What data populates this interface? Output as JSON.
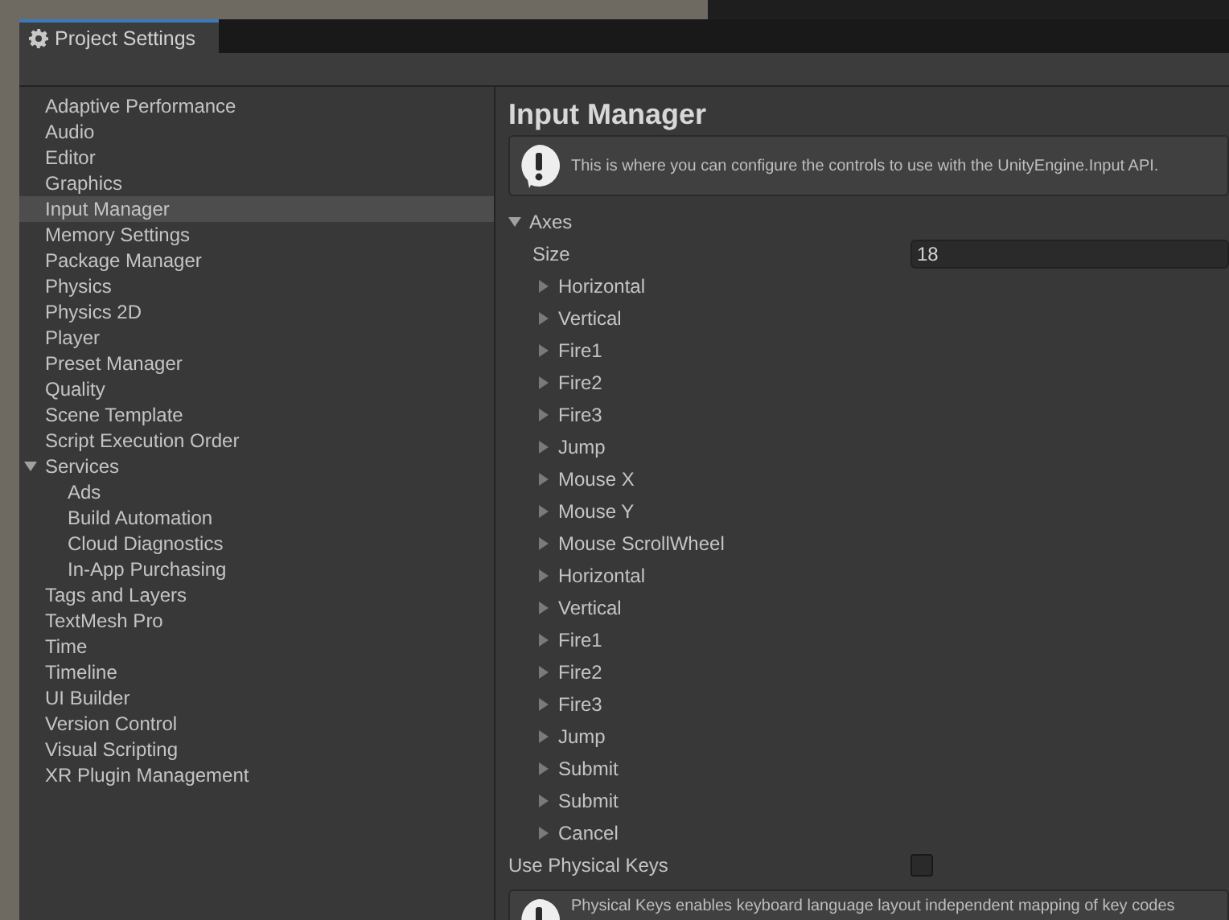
{
  "window": {
    "title": "Project Settings"
  },
  "sidebar": {
    "items": [
      {
        "label": "Adaptive Performance",
        "selected": false
      },
      {
        "label": "Audio",
        "selected": false
      },
      {
        "label": "Editor",
        "selected": false
      },
      {
        "label": "Graphics",
        "selected": false
      },
      {
        "label": "Input Manager",
        "selected": true
      },
      {
        "label": "Memory Settings",
        "selected": false
      },
      {
        "label": "Package Manager",
        "selected": false
      },
      {
        "label": "Physics",
        "selected": false
      },
      {
        "label": "Physics 2D",
        "selected": false
      },
      {
        "label": "Player",
        "selected": false
      },
      {
        "label": "Preset Manager",
        "selected": false
      },
      {
        "label": "Quality",
        "selected": false
      },
      {
        "label": "Scene Template",
        "selected": false
      },
      {
        "label": "Script Execution Order",
        "selected": false
      },
      {
        "label": "Services",
        "selected": false,
        "expanded": true,
        "children": [
          {
            "label": "Ads",
            "selected": false
          },
          {
            "label": "Build Automation",
            "selected": false
          },
          {
            "label": "Cloud Diagnostics",
            "selected": false
          },
          {
            "label": "In-App Purchasing",
            "selected": false
          }
        ]
      },
      {
        "label": "Tags and Layers",
        "selected": false
      },
      {
        "label": "TextMesh Pro",
        "selected": false
      },
      {
        "label": "Time",
        "selected": false
      },
      {
        "label": "Timeline",
        "selected": false
      },
      {
        "label": "UI Builder",
        "selected": false
      },
      {
        "label": "Version Control",
        "selected": false
      },
      {
        "label": "Visual Scripting",
        "selected": false
      },
      {
        "label": "XR Plugin Management",
        "selected": false
      }
    ]
  },
  "panel": {
    "title": "Input Manager",
    "help_text": "This is where you can configure the controls to use with the UnityEngine.Input API.",
    "axes": {
      "label": "Axes",
      "expanded": true,
      "size_label": "Size",
      "size_value": "18",
      "items": [
        {
          "label": "Horizontal",
          "expanded": false
        },
        {
          "label": "Vertical",
          "expanded": false
        },
        {
          "label": "Fire1",
          "expanded": false
        },
        {
          "label": "Fire2",
          "expanded": false
        },
        {
          "label": "Fire3",
          "expanded": false
        },
        {
          "label": "Jump",
          "expanded": false
        },
        {
          "label": "Mouse X",
          "expanded": false
        },
        {
          "label": "Mouse Y",
          "expanded": false
        },
        {
          "label": "Mouse ScrollWheel",
          "expanded": false
        },
        {
          "label": "Horizontal",
          "expanded": false
        },
        {
          "label": "Vertical",
          "expanded": false
        },
        {
          "label": "Fire1",
          "expanded": false
        },
        {
          "label": "Fire2",
          "expanded": false
        },
        {
          "label": "Fire3",
          "expanded": false
        },
        {
          "label": "Jump",
          "expanded": false
        },
        {
          "label": "Submit",
          "expanded": false
        },
        {
          "label": "Submit",
          "expanded": false
        },
        {
          "label": "Cancel",
          "expanded": false
        }
      ]
    },
    "use_physical_keys": {
      "label": "Use Physical Keys",
      "checked": false
    },
    "physical_keys_help": "Physical Keys enables keyboard language layout independent mapping of key codes"
  }
}
